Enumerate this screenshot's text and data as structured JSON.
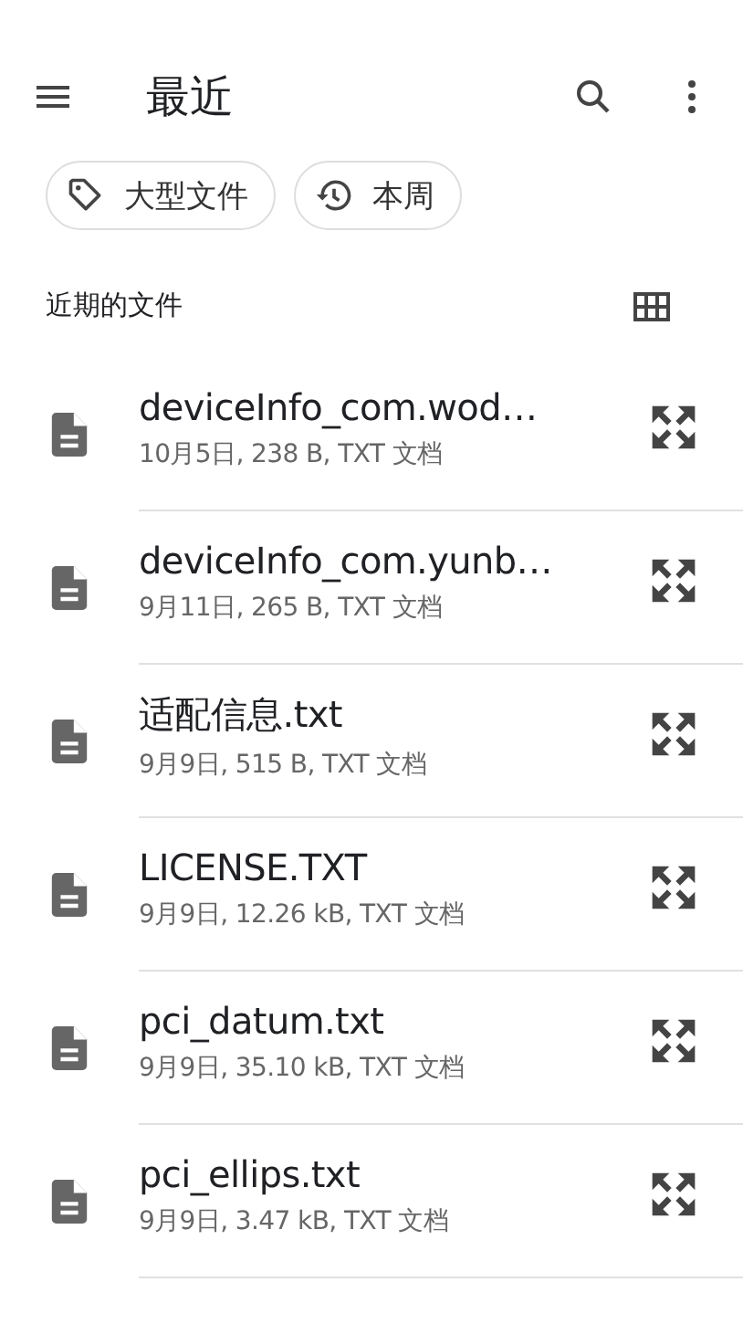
{
  "app_bar": {
    "title": "最近"
  },
  "chips": [
    {
      "label": "大型文件",
      "kind": "tag"
    },
    {
      "label": "本周",
      "kind": "history"
    }
  ],
  "section": {
    "title": "近期的文件"
  },
  "files": [
    {
      "name": "deviceInfo_com.wod…",
      "meta": "10月5日, 238 B, TXT 文档"
    },
    {
      "name": "deviceInfo_com.yunb…",
      "meta": "9月11日, 265 B, TXT 文档"
    },
    {
      "name": "适配信息.txt",
      "meta": "9月9日, 515 B, TXT 文档"
    },
    {
      "name": "LICENSE.TXT",
      "meta": "9月9日, 12.26 kB, TXT 文档"
    },
    {
      "name": "pci_datum.txt",
      "meta": "9月9日, 35.10 kB, TXT 文档"
    },
    {
      "name": "pci_ellips.txt",
      "meta": "9月9日, 3.47 kB, TXT 文档"
    }
  ]
}
